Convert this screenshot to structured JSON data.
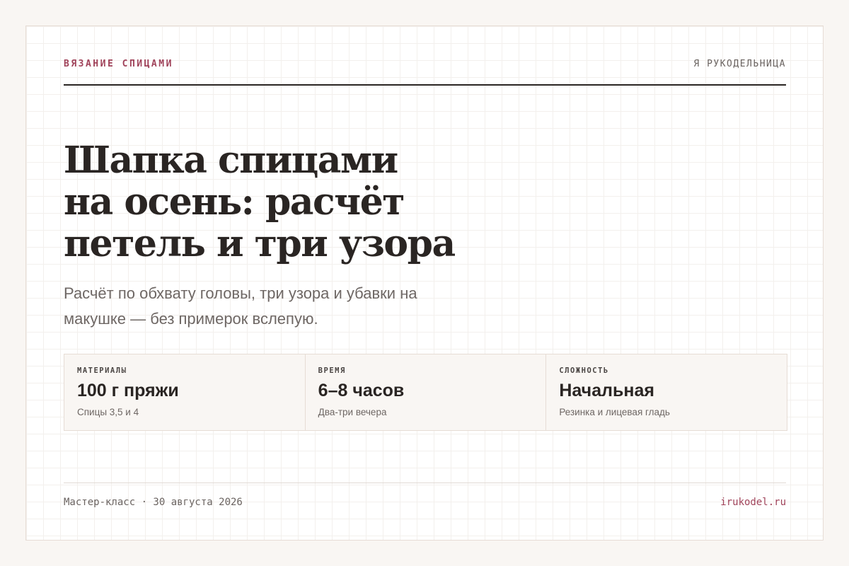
{
  "header": {
    "category": "ВЯЗАНИЕ СПИЦАМИ",
    "brand": "Я РУКОДЕЛЬНИЦА"
  },
  "article": {
    "title_lines": [
      "Шапка спицами",
      "на осень: расчёт",
      "петель и три узора"
    ],
    "subtitle_lines": [
      "Расчёт по обхвату головы, три узора и убавки на",
      "макушке — без примерок вслепую."
    ]
  },
  "stats": [
    {
      "label": "МАТЕРИАЛЫ",
      "value": "100 г пряжи",
      "note": "Спицы 3,5 и 4"
    },
    {
      "label": "ВРЕМЯ",
      "value": "6–8 часов",
      "note": "Два-три вечера"
    },
    {
      "label": "СЛОЖНОСТЬ",
      "value": "Начальная",
      "note": "Резинка и лицевая гладь"
    }
  ],
  "footer": {
    "meta": "Мастер-класс · 30 августа 2026",
    "url": "irukodel.ru"
  },
  "colors": {
    "accent": "#a0435a",
    "text": "#2a2523",
    "muted": "#6e6764",
    "panel": "#f9f6f3",
    "border": "#e6dcd5"
  }
}
